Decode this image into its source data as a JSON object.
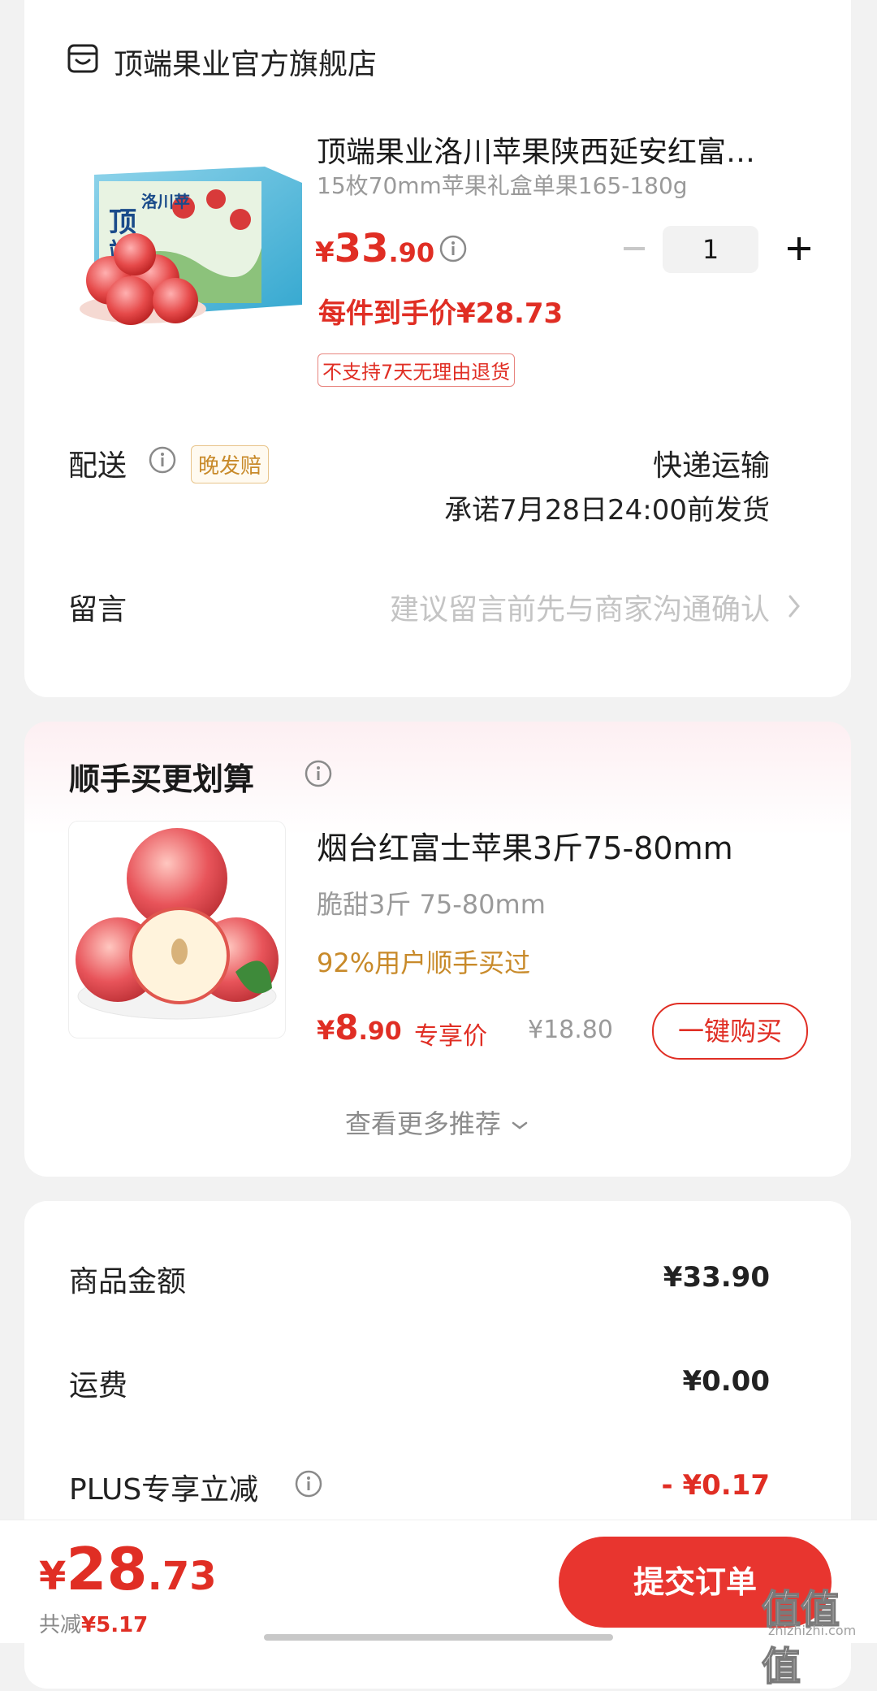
{
  "store": {
    "name": "顶端果业官方旗舰店",
    "icon": "store-icon"
  },
  "product": {
    "title": "顶端果业洛川苹果陕西延安红富…",
    "spec": "15枚70mm苹果礼盒单果165-180g",
    "price_yen": "¥",
    "price_int": "33",
    "price_dec": ".90",
    "quantity": "1",
    "per_item_price": "每件到手价¥28.73",
    "return_tag": "不支持7天无理由退货",
    "box_text": "洛川苹"
  },
  "delivery": {
    "label": "配送",
    "late_tag": "晚发赔",
    "method": "快递运输",
    "promise": "承诺7月28日24:00前发货"
  },
  "message": {
    "label": "留言",
    "placeholder": "建议留言前先与商家沟通确认"
  },
  "recommend": {
    "title": "顺手买更划算",
    "item": {
      "name": "烟台红富士苹果3斤75-80mm",
      "spec": "脆甜3斤 75-80mm",
      "bought_pct": "92%用户顺手买过",
      "price_yen": "¥",
      "price_int": "8",
      "price_dec": ".90",
      "exclusive_label": "专享价",
      "original_price": "¥18.80",
      "buy_label": "一键购买"
    },
    "more_label": "查看更多推荐"
  },
  "summary": {
    "rows": [
      {
        "label": "商品金额",
        "value": "¥33.90"
      },
      {
        "label": "运费",
        "value": "¥0.00"
      },
      {
        "label": "PLUS专享立减",
        "value": "- ¥0.17"
      }
    ]
  },
  "bottom": {
    "total_yen": "¥",
    "total_int": "28",
    "total_dec": ".73",
    "saved_label": "共减",
    "saved_value": "¥5.17",
    "submit_label": "提交订单",
    "watermark": "值值值",
    "watermark_sub": "zhizhizhi.com"
  },
  "colors": {
    "accent": "#e02e24",
    "gold": "#c88a2a",
    "background": "#f2f2f2"
  }
}
